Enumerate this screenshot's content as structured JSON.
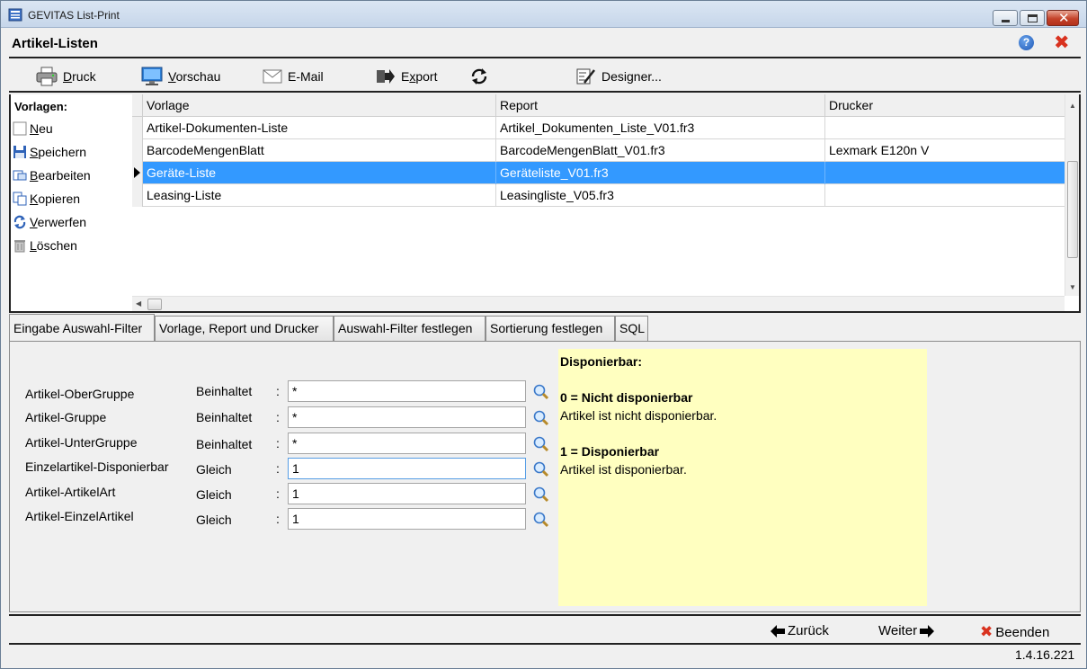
{
  "window": {
    "title": "GEVITAS List-Print"
  },
  "header": {
    "title": "Artikel-Listen"
  },
  "toolbar": {
    "druck_hot": "D",
    "druck_rest": "ruck",
    "vorschau_hot": "V",
    "vorschau_rest": "orschau",
    "email": "E-Mail",
    "export_pre": "E",
    "export_hot": "x",
    "export_rest": "port",
    "designer": "Designer..."
  },
  "vorlagen": {
    "title": "Vorlagen:",
    "neu_hot": "N",
    "neu_rest": "eu",
    "speichern_hot": "S",
    "speichern_rest": "peichern",
    "bearbeiten_hot": "B",
    "bearbeiten_rest": "earbeiten",
    "kopieren_hot": "K",
    "kopieren_rest": "opieren",
    "verwerfen_hot": "V",
    "verwerfen_rest": "erwerfen",
    "loeschen_hot": "L",
    "loeschen_rest": "öschen"
  },
  "grid": {
    "columns": [
      "Vorlage",
      "Report",
      "Drucker"
    ],
    "rows": [
      {
        "vorlage": "Artikel-Dokumenten-Liste",
        "report": "Artikel_Dokumenten_Liste_V01.fr3",
        "drucker": ""
      },
      {
        "vorlage": "BarcodeMengenBlatt",
        "report": "BarcodeMengenBlatt_V01.fr3",
        "drucker": "Lexmark E120n V"
      },
      {
        "vorlage": "Geräte-Liste",
        "report": "Geräteliste_V01.fr3",
        "drucker": "",
        "selected": true
      },
      {
        "vorlage": "Leasing-Liste",
        "report": "Leasingliste_V05.fr3",
        "drucker": ""
      }
    ]
  },
  "tabs": [
    "Eingabe Auswahl-Filter",
    "Vorlage, Report und Drucker",
    "Auswahl-Filter festlegen",
    "Sortierung festlegen",
    "SQL"
  ],
  "filters": [
    {
      "label": "Artikel-OberGruppe",
      "op": "Beinhaltet",
      "colon": ":",
      "value": "*"
    },
    {
      "label": "Artikel-Gruppe",
      "op": "Beinhaltet",
      "colon": ":",
      "value": "*"
    },
    {
      "label": "Artikel-UnterGruppe",
      "op": "Beinhaltet",
      "colon": ":",
      "value": "*"
    },
    {
      "label": "Einzelartikel-Disponierbar",
      "op": "Gleich",
      "colon": ":",
      "value": "1"
    },
    {
      "label": "Artikel-ArtikelArt",
      "op": "Gleich",
      "colon": ":",
      "value": "1"
    },
    {
      "label": "Artikel-EinzelArtikel",
      "op": "Gleich",
      "colon": ":",
      "value": "1"
    }
  ],
  "info": {
    "title": "Disponierbar:",
    "opt0_title": "0 = Nicht disponierbar",
    "opt0_desc": "Artikel ist nicht disponierbar.",
    "opt1_title": "1 = Disponierbar",
    "opt1_desc": "Artikel ist disponierbar."
  },
  "footer": {
    "back": "Zurück",
    "next": "Weiter",
    "quit": "Beenden"
  },
  "status": {
    "version": "1.4.16.221"
  },
  "colors": {
    "selection": "#3399ff",
    "info_bg": "#ffffc0",
    "close_red": "#d9321f"
  }
}
